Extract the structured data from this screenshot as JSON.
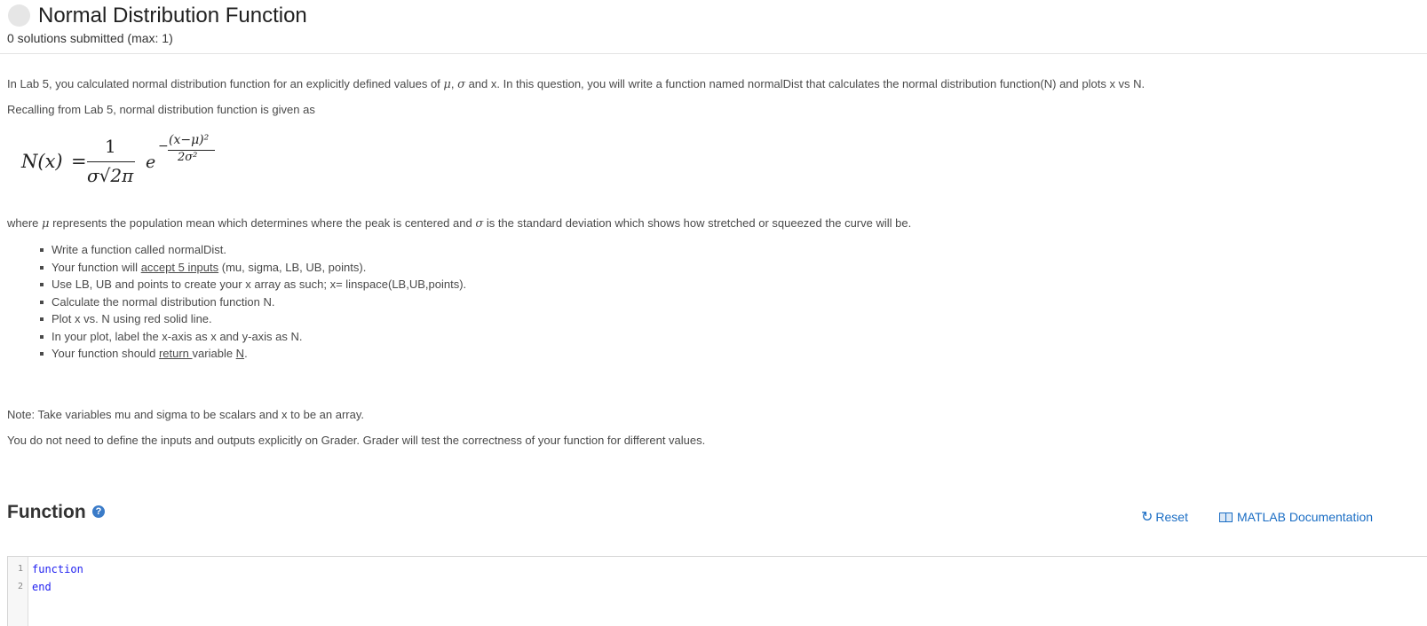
{
  "header": {
    "title": "Normal Distribution Function",
    "submissions": "0 solutions submitted (max: 1)"
  },
  "description": {
    "intro": {
      "part1": "In Lab 5, you calculated normal distribution function for an explicitly defined values of ",
      "mu": "μ",
      "sep": ", ",
      "sigma": "σ",
      "part2": " and x. In this question, you will write a function named normalDist that calculates the normal distribution function(N) and plots x vs N."
    },
    "recall": "Recalling from Lab 5, normal distribution function is given as",
    "formula": {
      "lhs": "N(x)",
      "eq": "=",
      "numerator": "1",
      "denominator": "σ√2π",
      "base": "e",
      "minus": "−",
      "exp_numerator": "(x−μ)²",
      "exp_denominator": "2σ²"
    },
    "where": {
      "part1": "where ",
      "mu": "μ",
      "part2": " represents the population mean which determines where the peak is centered and ",
      "sigma": "σ",
      "part3": " is the standard deviation which shows how stretched or squeezed the curve will be."
    },
    "bullets": {
      "b1": "Write a function called normalDist.",
      "b2_pre": "Your function will ",
      "b2_u": "accept 5 inputs",
      "b2_post": " (mu, sigma, LB, UB, points).",
      "b3": "Use LB, UB and points to create your x array as such;  x= linspace(LB,UB,points).",
      "b4": "Calculate the normal distribution function N.",
      "b5": "Plot x vs. N using red solid line.",
      "b6": "In your plot, label the x-axis as x and y-axis as N.",
      "b7_pre": "Your function should ",
      "b7_u": "return ",
      "b7_mid": "variable ",
      "b7_u2": "N",
      "b7_post": "."
    },
    "note": "Note: Take variables mu and sigma to be scalars and x to be an array.",
    "grader": "You do not need to define the inputs and outputs explicitly on Grader. Grader will test the correctness of your function for different values."
  },
  "function_section": {
    "title": "Function",
    "help_glyph": "?",
    "reset_label": "Reset",
    "reset_glyph": "↻",
    "docs_label": "MATLAB Documentation"
  },
  "editor": {
    "lines": [
      {
        "num": "1",
        "code": "function"
      },
      {
        "num": "2",
        "code": "end"
      }
    ]
  },
  "colors": {
    "link": "#1a6dc4",
    "keyword": "#1f1ff0",
    "help_icon": "#3a7bc8"
  }
}
